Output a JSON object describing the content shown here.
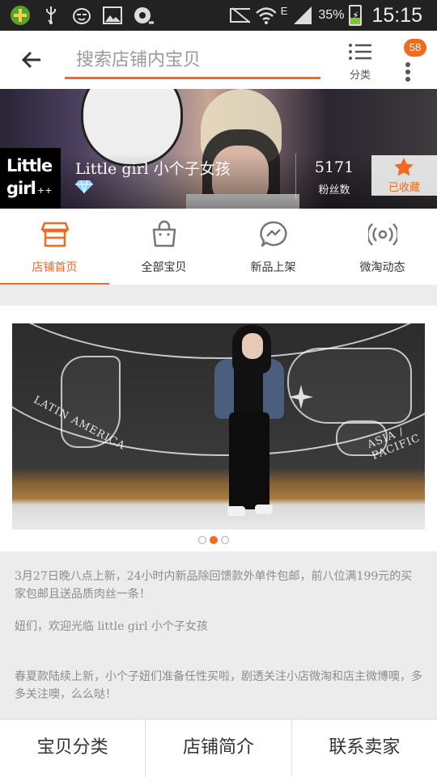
{
  "status_bar": {
    "battery": "35%",
    "battery_level": 0.35,
    "network": "E",
    "time": "15:15"
  },
  "header": {
    "search_placeholder": "搜索店铺内宝贝",
    "category_label": "分类",
    "message_count": "58"
  },
  "shop": {
    "logo_line1": "Little",
    "logo_line2": "girl",
    "logo_mark": "++",
    "name": "Little girl   小个子女孩",
    "fans_count": "5171",
    "fans_label": "粉丝数",
    "favorite_label": "已收藏"
  },
  "tabs": [
    {
      "label": "店铺首页",
      "icon": "shop-icon",
      "active": true
    },
    {
      "label": "全部宝贝",
      "icon": "bag-icon",
      "active": false
    },
    {
      "label": "新品上架",
      "icon": "new-arrival-icon",
      "active": false
    },
    {
      "label": "微淘动态",
      "icon": "broadcast-icon",
      "active": false
    }
  ],
  "carousel": {
    "map_labels": [
      "LATIN AMERICA",
      "ASIA / PACIFIC"
    ],
    "page_count": 3,
    "active_page": 2
  },
  "notice": {
    "p1": "3月27日晚八点上新，24小时内新品除回馈款外单件包邮，前八位满199元的买家包邮且送品质肉丝一条！",
    "p2": "妞们，欢迎光临 little girl 小个子女孩",
    "p3": "春夏款陆续上新，小个子妞们准备任性买啦，剧透关注小店微淘和店主微博噢，多多关注噢，么么哒！"
  },
  "bottom_bar": {
    "categories": "宝贝分类",
    "shop_intro": "店铺简介",
    "contact": "联系卖家"
  },
  "colors": {
    "accent": "#f06a1f"
  }
}
